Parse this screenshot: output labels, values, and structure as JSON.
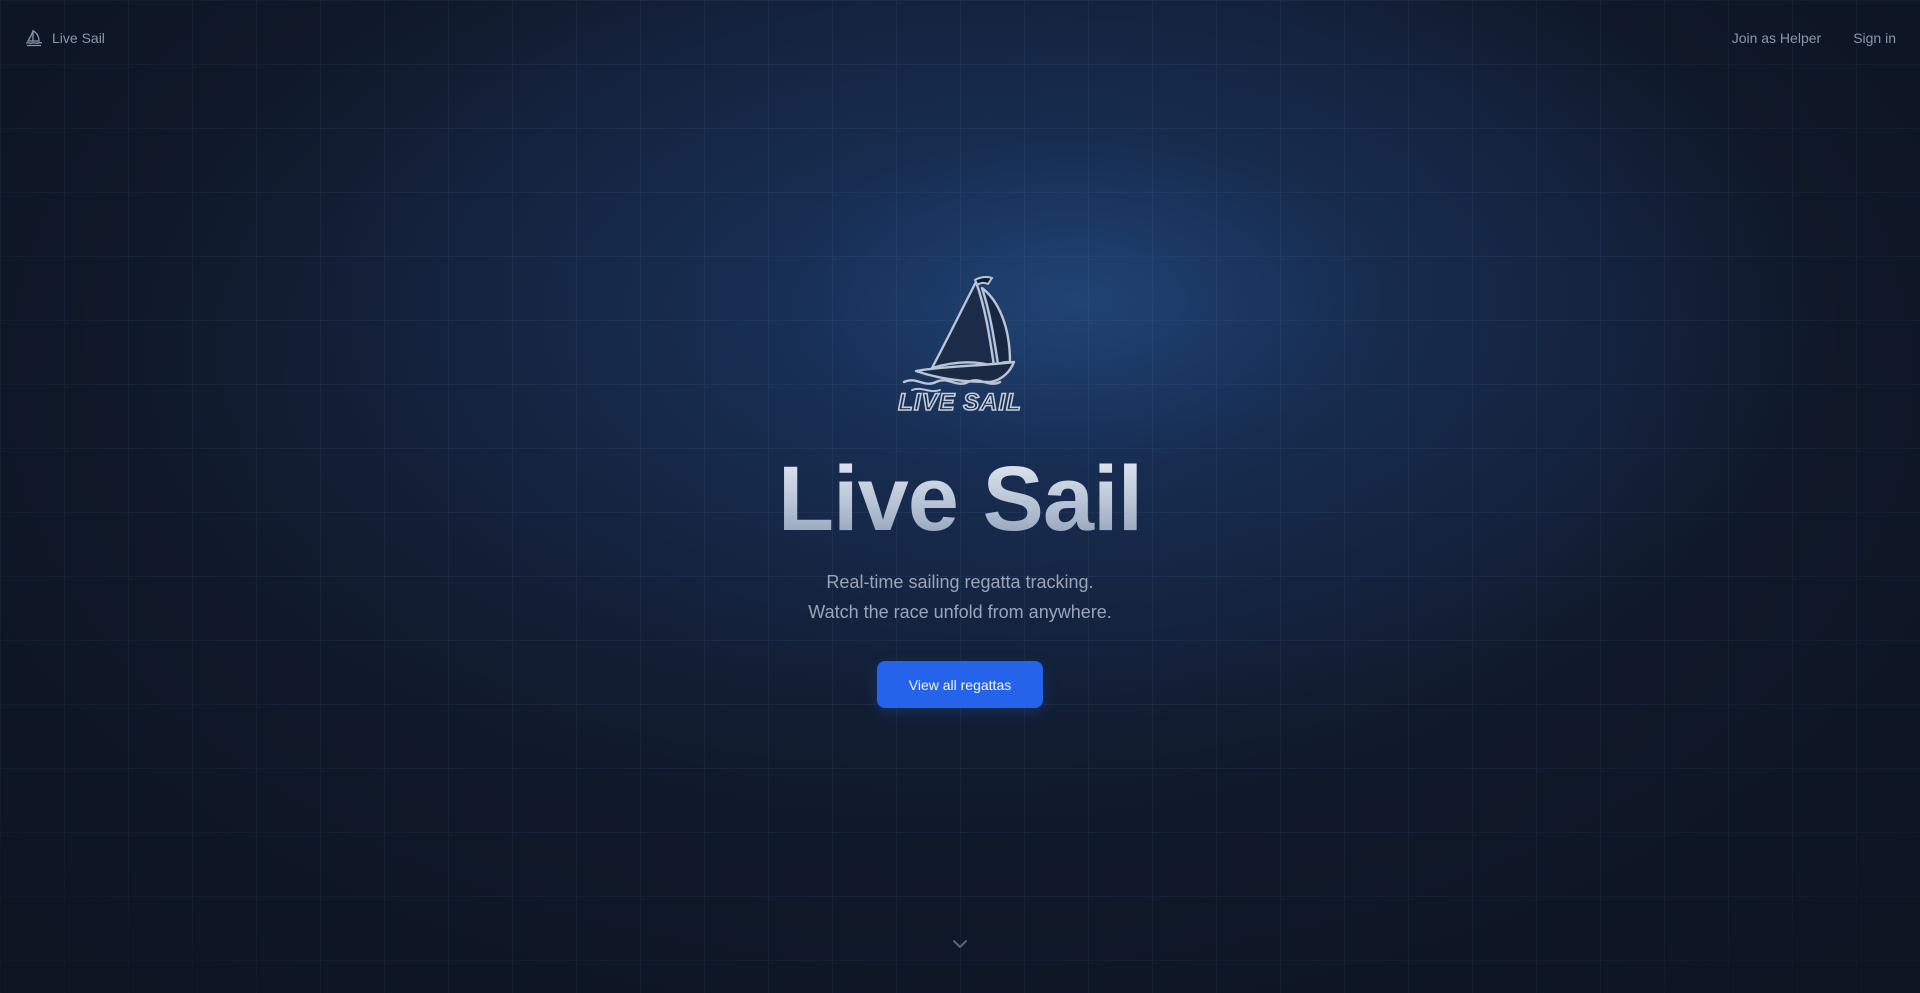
{
  "nav": {
    "brand_label": "Live Sail",
    "brand_icon": "sailboat-icon",
    "links": [
      {
        "label": "Join as Helper"
      },
      {
        "label": "Sign in"
      }
    ]
  },
  "hero": {
    "logo_icon": "sailboat-logo",
    "logo_text": "LIVE SAIL",
    "title": "Live Sail",
    "tagline_line1": "Real-time sailing regatta tracking.",
    "tagline_line2": "Watch the race unfold from anywhere.",
    "cta_label": "View all regattas",
    "scroll_icon": "chevron-down-icon"
  },
  "colors": {
    "background": "#111a2c",
    "accent": "#2563eb",
    "muted_text": "#8a96aa"
  }
}
